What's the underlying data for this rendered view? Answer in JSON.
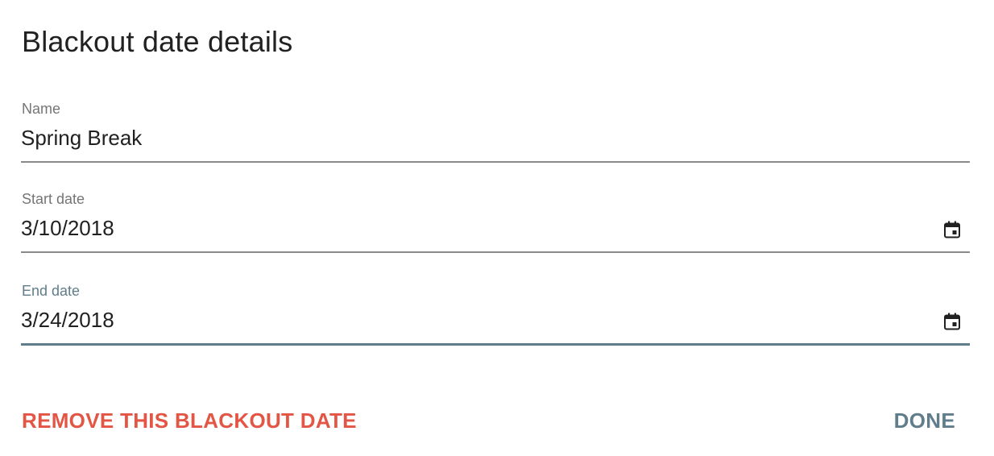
{
  "dialog": {
    "title": "Blackout date details"
  },
  "fields": {
    "name": {
      "label": "Name",
      "value": "Spring Break"
    },
    "start_date": {
      "label": "Start date",
      "value": "3/10/2018",
      "icon": "calendar-icon"
    },
    "end_date": {
      "label": "End date",
      "value": "3/24/2018",
      "icon": "calendar-icon",
      "focused": true
    }
  },
  "actions": {
    "remove_label": "REMOVE THIS BLACKOUT DATE",
    "done_label": "DONE"
  },
  "colors": {
    "destructive": "#e35545",
    "accent": "#607d8b",
    "label": "#757575",
    "text": "#212121",
    "underline": "#8a8a8a"
  }
}
